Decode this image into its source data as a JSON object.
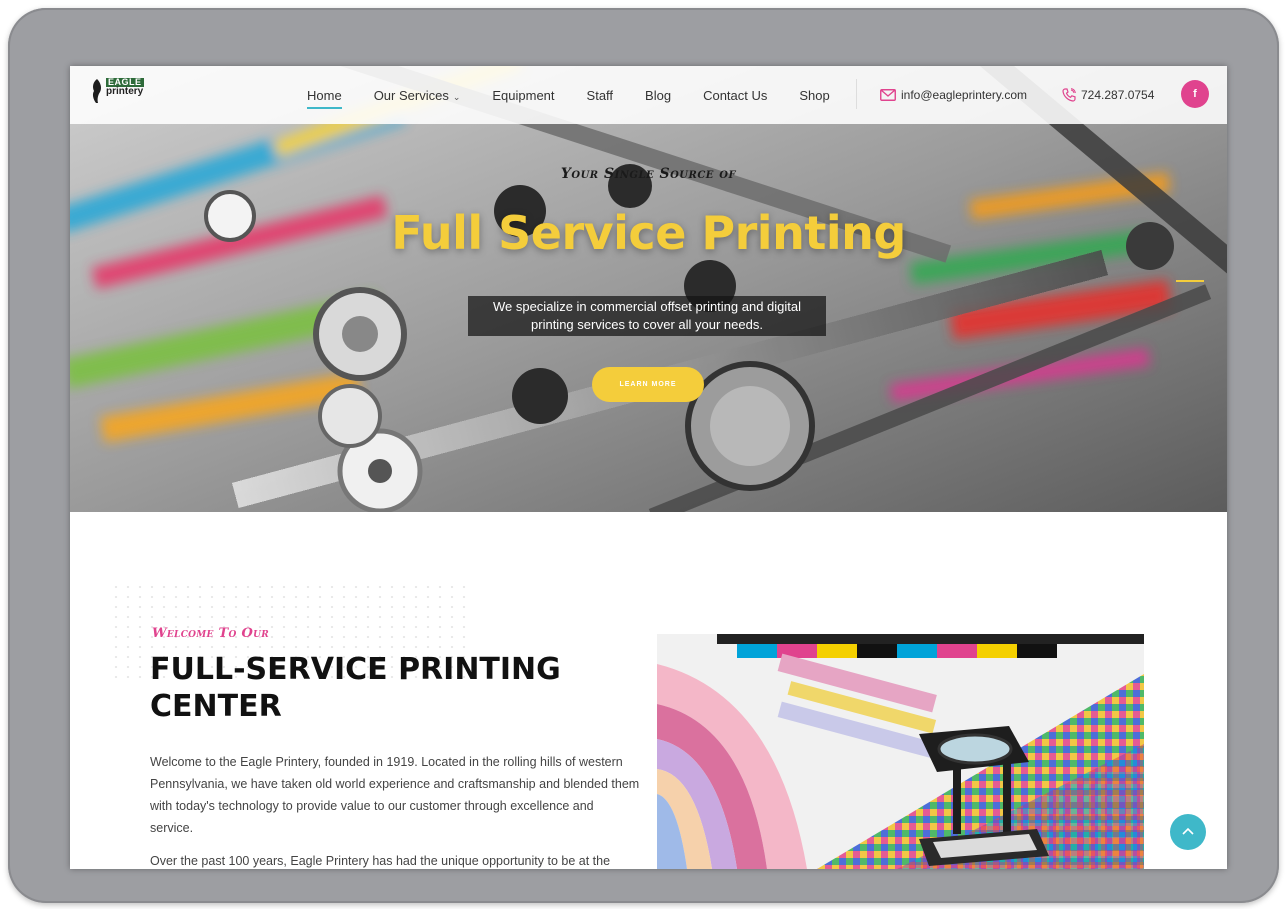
{
  "logo": {
    "line1": "EAGLE",
    "line2": "printery"
  },
  "nav": {
    "home": "Home",
    "services": "Our Services",
    "equipment": "Equipment",
    "staff": "Staff",
    "blog": "Blog",
    "contact": "Contact Us",
    "shop": "Shop"
  },
  "contact": {
    "email": "info@eagleprintery.com",
    "phone": "724.287.0754"
  },
  "social": {
    "facebook": "f"
  },
  "hero": {
    "pretitle": "Your Single Source of",
    "title": "Full Service Printing",
    "subtitle_line1": "We specialize in commercial offset printing and digital",
    "subtitle_line2": "printing services to cover all your needs.",
    "button": "LEARN MORE"
  },
  "about": {
    "kicker": "Welcome To Our",
    "title_line1": "FULL-SERVICE PRINTING",
    "title_line2": "CENTER",
    "para1": "Welcome to the Eagle Printery, founded in 1919. Located in the rolling hills of western Pennsylvania, we have taken old world experience and craftsmanship and blended them with today's technology to provide value to our customer through excellence and service.",
    "para2": "Over the past 100 years, Eagle Printery has had the unique opportunity to be at the"
  },
  "colors": {
    "accent_pink": "#e0438e",
    "accent_yellow": "#f4cd3b",
    "accent_teal": "#3fb8c9",
    "frame_gray": "#9d9ea2"
  },
  "icons": [
    "mail-icon",
    "phone-icon",
    "facebook-icon",
    "chevron-down-icon",
    "arrow-up-icon",
    "eagle-logo-icon"
  ]
}
